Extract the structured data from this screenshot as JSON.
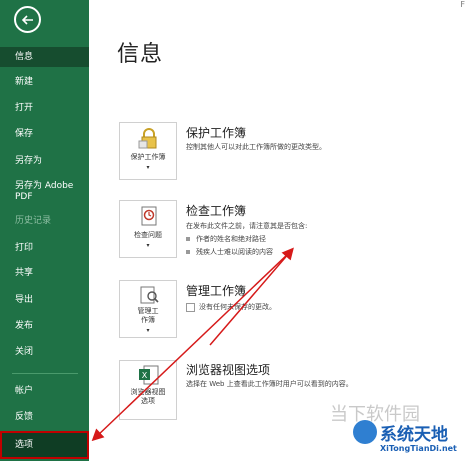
{
  "sidebar": {
    "back_icon": "arrow-left-icon",
    "items": [
      {
        "label": "信息"
      },
      {
        "label": "新建"
      },
      {
        "label": "打开"
      },
      {
        "label": "保存"
      },
      {
        "label": "另存为"
      },
      {
        "label": "另存为 Adobe\nPDF"
      },
      {
        "label": "历史记录"
      },
      {
        "label": "打印"
      },
      {
        "label": "共享"
      },
      {
        "label": "导出"
      },
      {
        "label": "发布"
      },
      {
        "label": "关闭"
      },
      {
        "label": "帐户"
      },
      {
        "label": "反馈"
      },
      {
        "label": "选项"
      }
    ]
  },
  "main": {
    "title": "信息",
    "top_right": "F",
    "sections": [
      {
        "tile_label": "保护工作簿",
        "title": "保护工作簿",
        "desc": "控制其他人可以对此工作簿所做的更改类型。"
      },
      {
        "tile_label": "检查问题",
        "title": "检查工作簿",
        "desc": "在发布此文件之前，请注意其是否包含:",
        "bullets": [
          "作者的姓名和绝对路径",
          "残疾人士难以阅读的内容"
        ]
      },
      {
        "tile_label": "管理工\n作簿",
        "title": "管理工作簿",
        "desc": "没有任何未保存的更改。"
      },
      {
        "tile_label": "浏览器视图\n选项",
        "title": "浏览器视图选项",
        "desc": "选择在 Web 上查看此工作簿时用户可以看到的内容。"
      }
    ]
  },
  "watermark": {
    "text1": "当下软件园",
    "text2": "系统天地",
    "text3": "XiTongTianDi.net"
  },
  "colors": {
    "sidebar": "#1f7246",
    "active": "#164d2f",
    "highlight": "#c00000"
  }
}
